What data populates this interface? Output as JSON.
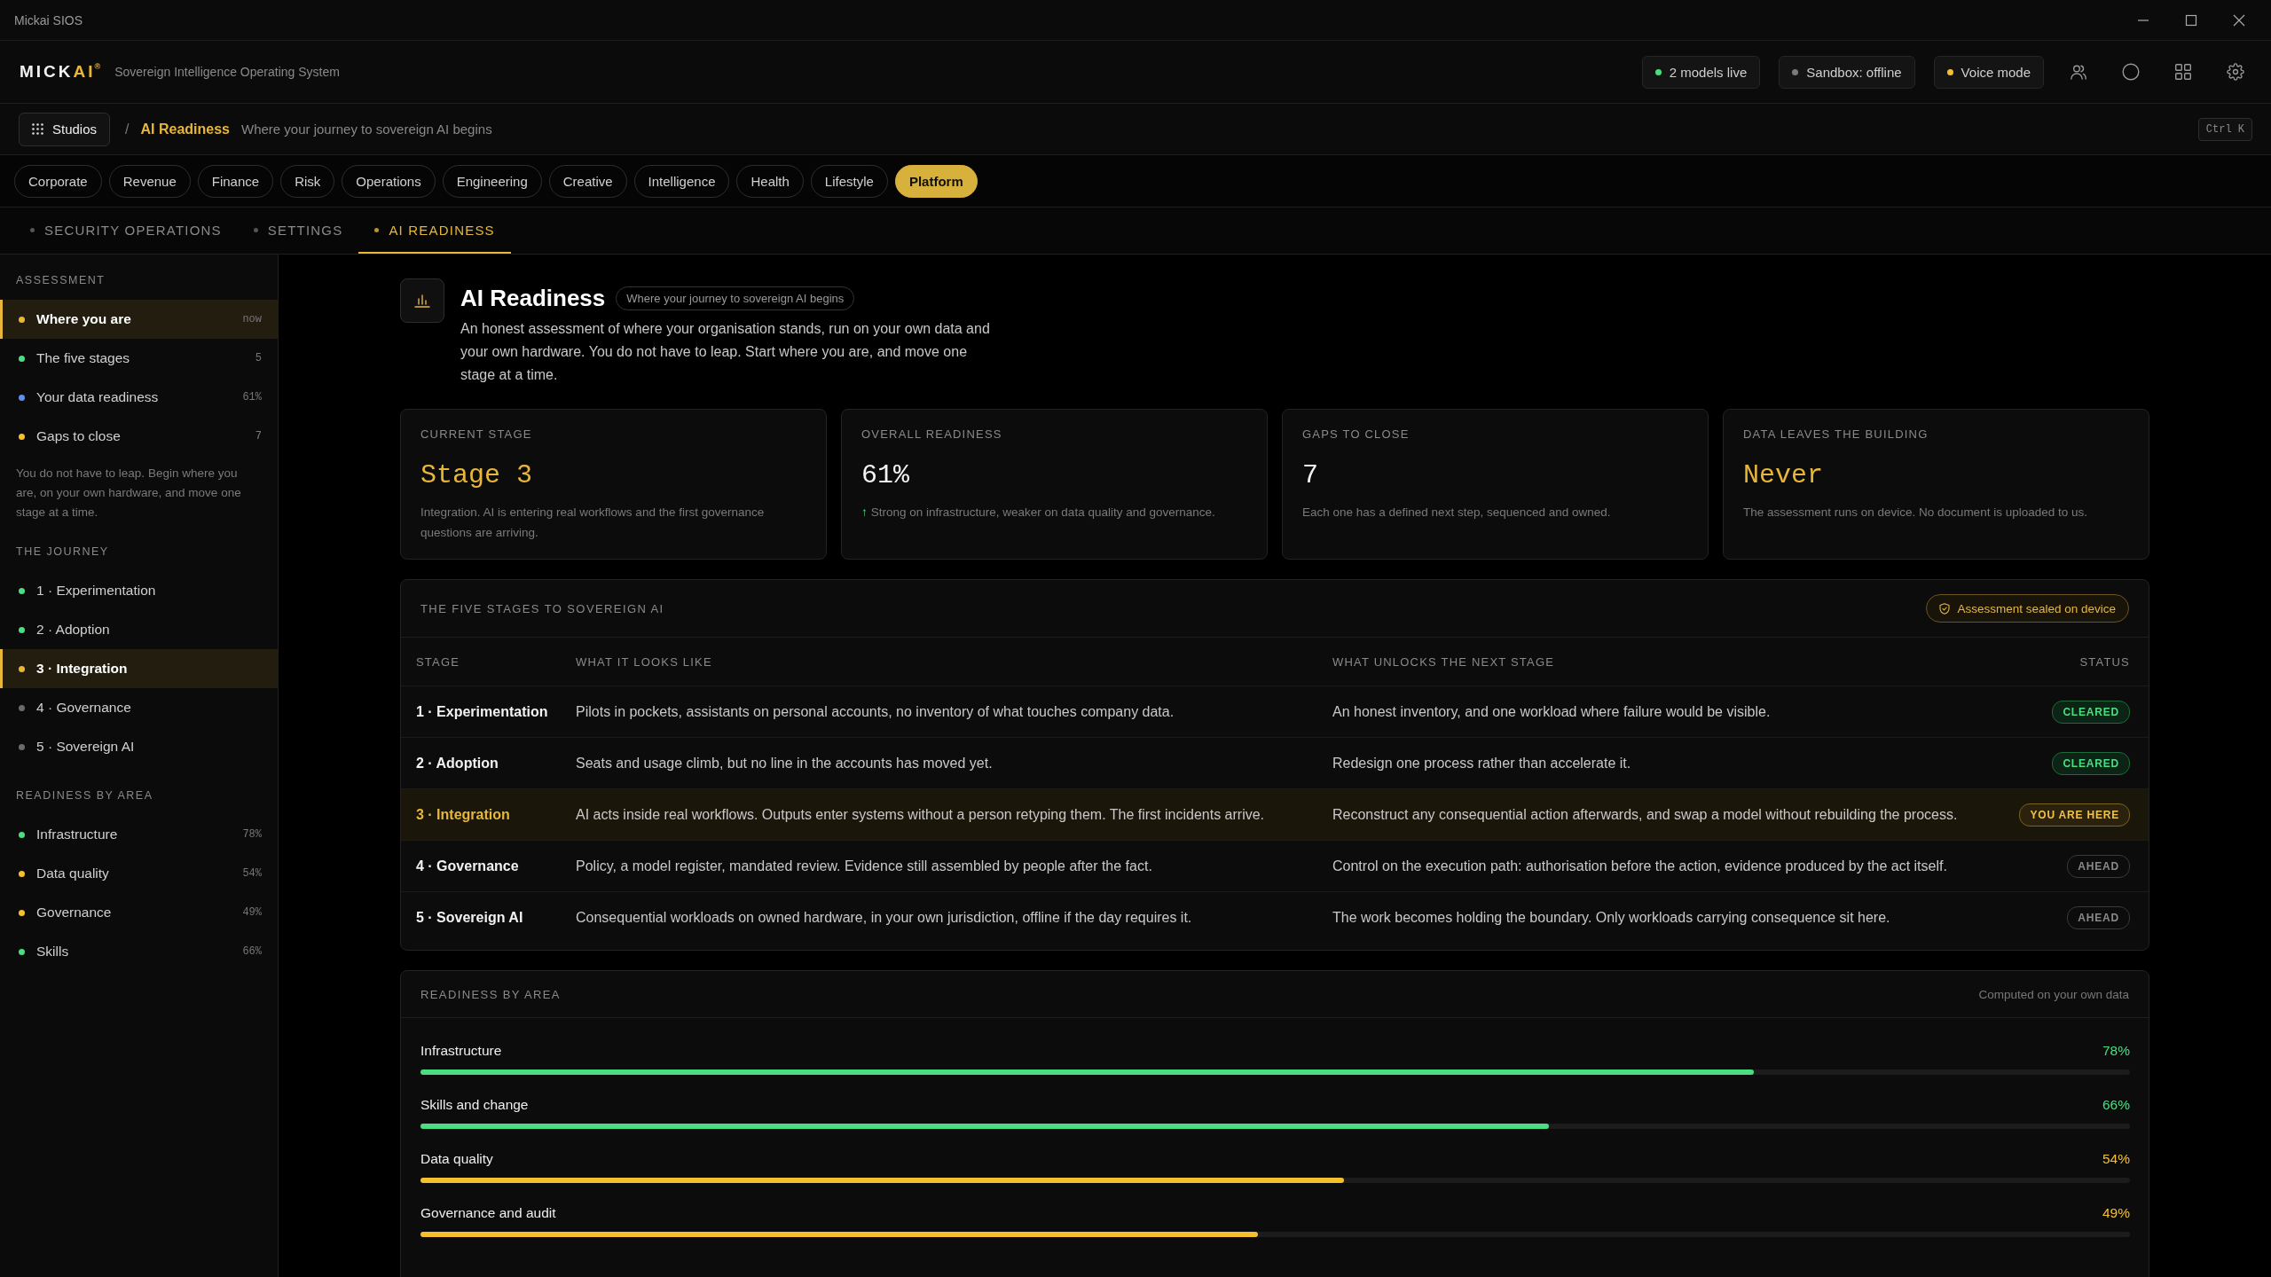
{
  "window": {
    "title": "Mickai SIOS"
  },
  "header": {
    "logo": {
      "text": "MICK",
      "accent": "AI",
      "mark": "®"
    },
    "tagline": "Sovereign Intelligence Operating System",
    "status_pills": [
      {
        "label": "2 models live",
        "color": "#4ade80"
      },
      {
        "label": "Sandbox: offline",
        "color": "#7a7a7a"
      },
      {
        "label": "Voice mode",
        "color": "#f5c02e"
      }
    ]
  },
  "breadcrumb": {
    "studios_button": "Studios",
    "separator": "/",
    "current": "AI Readiness",
    "subtitle": "Where your journey to sovereign AI begins",
    "shortcut": "Ctrl K"
  },
  "categories": [
    {
      "label": "Corporate",
      "selected": false
    },
    {
      "label": "Revenue",
      "selected": false
    },
    {
      "label": "Finance",
      "selected": false
    },
    {
      "label": "Risk",
      "selected": false
    },
    {
      "label": "Operations",
      "selected": false
    },
    {
      "label": "Engineering",
      "selected": false
    },
    {
      "label": "Creative",
      "selected": false
    },
    {
      "label": "Intelligence",
      "selected": false
    },
    {
      "label": "Health",
      "selected": false
    },
    {
      "label": "Lifestyle",
      "selected": false
    },
    {
      "label": "Platform",
      "selected": true
    }
  ],
  "subtabs": [
    {
      "label": "SECURITY OPERATIONS",
      "selected": false
    },
    {
      "label": "SETTINGS",
      "selected": false
    },
    {
      "label": "AI READINESS",
      "selected": true
    }
  ],
  "sidebar": {
    "sections": [
      {
        "title": "ASSESSMENT",
        "items": [
          {
            "label": "Where you are",
            "value": "now",
            "color": "#e8b73a",
            "selected": true
          },
          {
            "label": "The five stages",
            "value": "5",
            "color": "#4ade80",
            "selected": false
          },
          {
            "label": "Your data readiness",
            "value": "61%",
            "color": "#5b8ff0",
            "selected": false
          },
          {
            "label": "Gaps to close",
            "value": "7",
            "color": "#f5c02e",
            "selected": false
          }
        ],
        "note": "You do not have to leap. Begin where you are, on your own hardware, and move one stage at a time."
      },
      {
        "title": "THE JOURNEY",
        "items": [
          {
            "label": "1 · Experimentation",
            "color": "#4ade80",
            "selected": false
          },
          {
            "label": "2 · Adoption",
            "color": "#4ade80",
            "selected": false
          },
          {
            "label": "3 · Integration",
            "color": "#e8b73a",
            "selected": true
          },
          {
            "label": "4 · Governance",
            "color": "#6b6b6b",
            "selected": false
          },
          {
            "label": "5 · Sovereign AI",
            "color": "#6b6b6b",
            "selected": false
          }
        ]
      },
      {
        "title": "READINESS BY AREA",
        "items": [
          {
            "label": "Infrastructure",
            "value": "78%",
            "color": "#4ade80",
            "selected": false
          },
          {
            "label": "Data quality",
            "value": "54%",
            "color": "#f5c02e",
            "selected": false
          },
          {
            "label": "Governance",
            "value": "49%",
            "color": "#f5c02e",
            "selected": false
          },
          {
            "label": "Skills",
            "value": "66%",
            "color": "#4ade80",
            "selected": false
          }
        ]
      }
    ]
  },
  "page": {
    "title": "AI Readiness",
    "tag": "Where your journey to sovereign AI begins",
    "description": "An honest assessment of where your organisation stands, run on your own data and your own hardware. You do not have to leap. Start where you are, and move one stage at a time."
  },
  "stat_cards": [
    {
      "label": "CURRENT STAGE",
      "value": "Stage 3",
      "accent": true,
      "note": "Integration. AI is entering real workflows and the first governance questions are arriving."
    },
    {
      "label": "OVERALL READINESS",
      "value": "61%",
      "accent": false,
      "trend": "↑",
      "note": "Strong on infrastructure, weaker on data quality and governance."
    },
    {
      "label": "GAPS TO CLOSE",
      "value": "7",
      "accent": false,
      "note": "Each one has a defined next step, sequenced and owned."
    },
    {
      "label": "DATA LEAVES THE BUILDING",
      "value": "Never",
      "accent": true,
      "note": "The assessment runs on device. No document is uploaded to us."
    }
  ],
  "stages_table": {
    "title": "THE FIVE STAGES TO SOVEREIGN AI",
    "badge": "Assessment sealed on device",
    "columns": [
      "STAGE",
      "WHAT IT LOOKS LIKE",
      "WHAT UNLOCKS THE NEXT STAGE",
      "STATUS"
    ],
    "rows": [
      {
        "stage": "1 · Experimentation",
        "looks_like": "Pilots in pockets, assistants on personal accounts, no inventory of what touches company data.",
        "unlocks": "An honest inventory, and one workload where failure would be visible.",
        "status": {
          "kind": "cleared",
          "label": "CLEARED"
        },
        "current": false
      },
      {
        "stage": "2 · Adoption",
        "looks_like": "Seats and usage climb, but no line in the accounts has moved yet.",
        "unlocks": "Redesign one process rather than accelerate it.",
        "status": {
          "kind": "cleared",
          "label": "CLEARED"
        },
        "current": false
      },
      {
        "stage": "3 · Integration",
        "looks_like": "AI acts inside real workflows. Outputs enter systems without a person retyping them. The first incidents arrive.",
        "unlocks": "Reconstruct any consequential action afterwards, and swap a model without rebuilding the process.",
        "status": {
          "kind": "current",
          "label": "YOU ARE HERE"
        },
        "current": true
      },
      {
        "stage": "4 · Governance",
        "looks_like": "Policy, a model register, mandated review. Evidence still assembled by people after the fact.",
        "unlocks": "Control on the execution path: authorisation before the action, evidence produced by the act itself.",
        "status": {
          "kind": "ahead",
          "label": "AHEAD"
        },
        "current": false
      },
      {
        "stage": "5 · Sovereign AI",
        "looks_like": "Consequential workloads on owned hardware, in your own jurisdiction, offline if the day requires it.",
        "unlocks": "The work becomes holding the boundary. Only workloads carrying consequence sit here.",
        "status": {
          "kind": "ahead",
          "label": "AHEAD"
        },
        "current": false
      }
    ]
  },
  "readiness_by_area": {
    "title": "READINESS BY AREA",
    "note": "Computed on your own data",
    "areas": [
      {
        "label": "Infrastructure",
        "reading": "78%",
        "level": 0.78,
        "color": "#4ade80"
      },
      {
        "label": "Skills and change",
        "reading": "66%",
        "level": 0.66,
        "color": "#4ade80"
      },
      {
        "label": "Data quality",
        "reading": "54%",
        "level": 0.54,
        "color": "#f5c02e"
      },
      {
        "label": "Governance and audit",
        "reading": "49%",
        "level": 0.49,
        "color": "#f5c02e"
      }
    ]
  }
}
